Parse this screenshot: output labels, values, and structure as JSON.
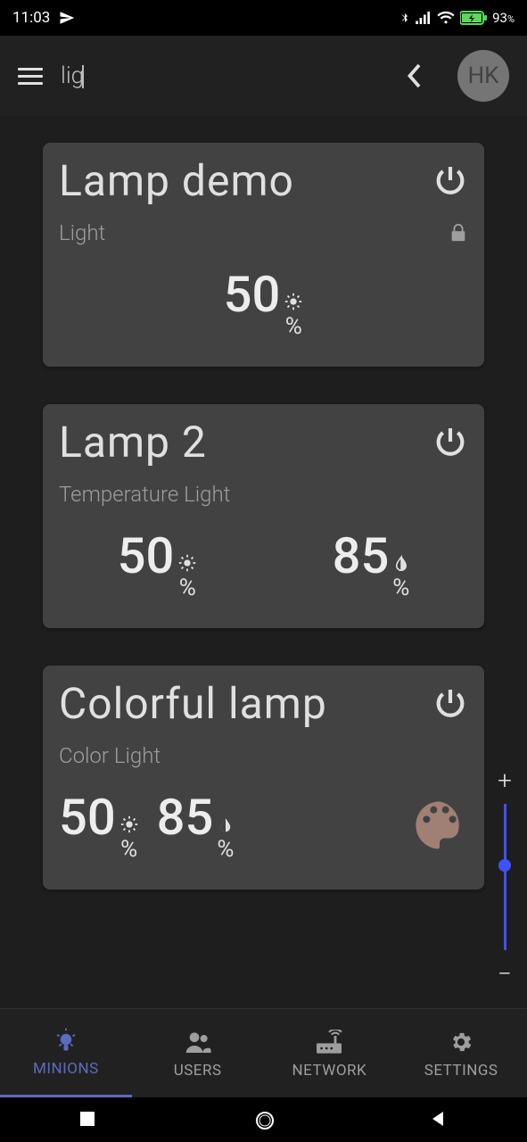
{
  "status": {
    "time": "11:03",
    "battery": "93",
    "battery_pct": "%"
  },
  "header": {
    "search_value": "lig",
    "avatar": "HK"
  },
  "cards": [
    {
      "title": "Lamp demo",
      "subtitle": "Light",
      "locked": true,
      "brightness": "50"
    },
    {
      "title": "Lamp 2",
      "subtitle": "Temperature Light",
      "brightness": "50",
      "temperature": "85"
    },
    {
      "title": "Colorful lamp",
      "subtitle": "Color Light",
      "brightness": "50",
      "temperature": "85",
      "palette_color": "#a08074"
    }
  ],
  "nav": {
    "minions": "MINIONS",
    "users": "USERS",
    "network": "NETWORK",
    "settings": "SETTINGS"
  },
  "pct": "%"
}
